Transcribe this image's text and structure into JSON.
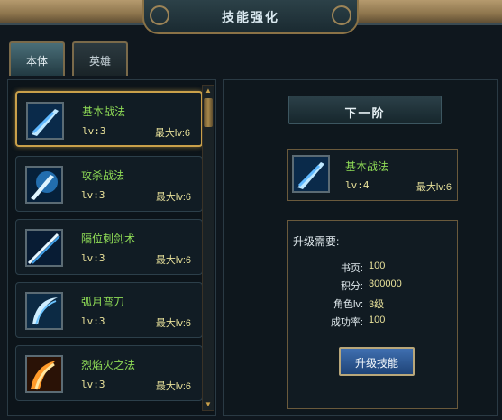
{
  "window": {
    "title": "技能强化"
  },
  "tabs": [
    {
      "label": "本体",
      "active": true
    },
    {
      "label": "英雄",
      "active": false
    }
  ],
  "skills": [
    {
      "name": "基本战法",
      "level": "lv:3",
      "max": "最大lv:6",
      "icon": "sword-slash-icon",
      "selected": true
    },
    {
      "name": "攻杀战法",
      "level": "lv:3",
      "max": "最大lv:6",
      "icon": "blue-burst-icon",
      "selected": false
    },
    {
      "name": "隔位刺剑术",
      "level": "lv:3",
      "max": "最大lv:6",
      "icon": "sword-thrust-icon",
      "selected": false
    },
    {
      "name": "弧月弯刀",
      "level": "lv:3",
      "max": "最大lv:6",
      "icon": "crescent-blade-icon",
      "selected": false
    },
    {
      "name": "烈焰火之法",
      "level": "lv:3",
      "max": "最大lv:6",
      "icon": "fire-slash-icon",
      "selected": false
    }
  ],
  "next_stage": {
    "header": "下一阶",
    "skill_name": "基本战法",
    "level": "lv:4",
    "max": "最大lv:6"
  },
  "requirements": {
    "title": "升级需要:",
    "rows": [
      {
        "label": "书页:",
        "value": "100"
      },
      {
        "label": "积分:",
        "value": "300000"
      },
      {
        "label": "角色lv:",
        "value": "3级"
      },
      {
        "label": "成功率:",
        "value": "100"
      }
    ]
  },
  "actions": {
    "upgrade_label": "升级技能"
  },
  "colors": {
    "skill_name": "#8fdc56",
    "level_text": "#e8e19a",
    "selected_border": "#c9a04a",
    "button_blue": "#2f5a96"
  }
}
